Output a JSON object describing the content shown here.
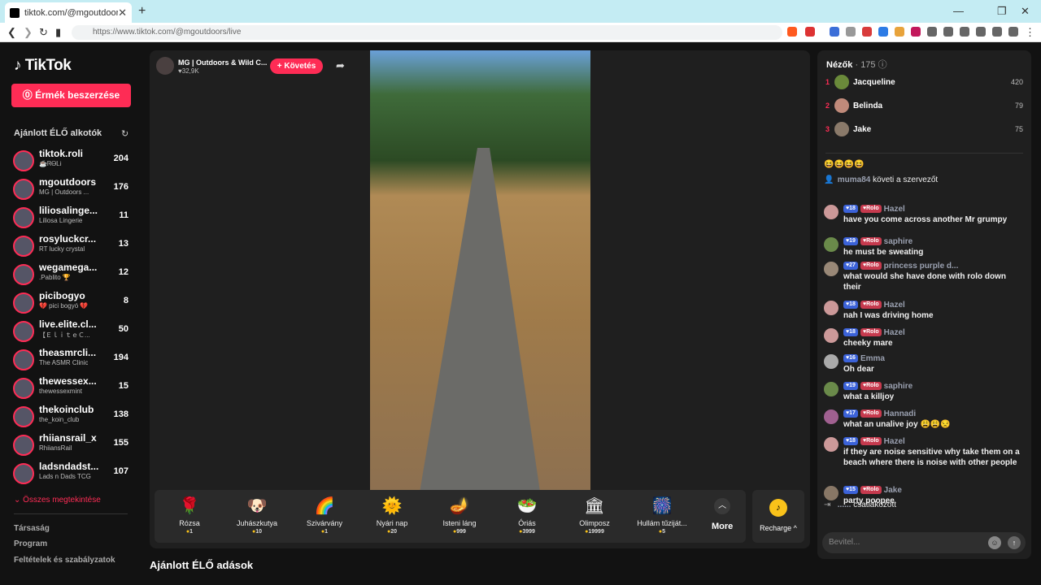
{
  "browser": {
    "tab_title": "tiktok.com/@mgoutdoors/liv",
    "url": "https://www.tiktok.com/@mgoutdoors/live"
  },
  "sidebar": {
    "logo": "TikTok",
    "coins_button": "Érmék beszerzése",
    "section_title": "Ajánlott ÉLŐ alkotók",
    "creators": [
      {
        "username": "tiktok.roli",
        "subtitle": "☕ᏒᎾᏞᎥ",
        "viewers": "204"
      },
      {
        "username": "mgoutdoors",
        "subtitle": "MG | Outdoors ...",
        "viewers": "176"
      },
      {
        "username": "liliosalinge...",
        "subtitle": "Liliosa Lingerie",
        "viewers": "11"
      },
      {
        "username": "rosyluckcr...",
        "subtitle": "RT lucky crystal",
        "viewers": "13"
      },
      {
        "username": "wegamega...",
        "subtitle": ".Pablito 🏆",
        "viewers": "12"
      },
      {
        "username": "picibogyo",
        "subtitle": "💔 pici bogyó 💔",
        "viewers": "8"
      },
      {
        "username": "live.elite.cl...",
        "subtitle": "【ＥｌｉｔｅＣ...",
        "viewers": "50"
      },
      {
        "username": "theasmrcli...",
        "subtitle": "The ASMR Clinic",
        "viewers": "194"
      },
      {
        "username": "thewessex...",
        "subtitle": "thewessexmint",
        "viewers": "15"
      },
      {
        "username": "thekoinclub",
        "subtitle": "the_koin_club",
        "viewers": "138"
      },
      {
        "username": "rhiiansrail_x",
        "subtitle": "RhiiansRail",
        "viewers": "155"
      },
      {
        "username": "ladsndadst...",
        "subtitle": "Lads n Dads TCG",
        "viewers": "107"
      }
    ],
    "see_all": "Összes megtekintése",
    "footer": [
      "Társaság",
      "Program",
      "Feltételek és szabályzatok"
    ]
  },
  "stream": {
    "host_name": "MG | Outdoors & Wild C...",
    "likes": "32,9K",
    "follow_button": "+ Követés",
    "gifts": [
      {
        "name": "Rózsa",
        "price": "1",
        "icon": "🌹"
      },
      {
        "name": "Juhászkutya",
        "price": "10",
        "icon": "🐶"
      },
      {
        "name": "Szivárvány",
        "price": "1",
        "icon": "🌈"
      },
      {
        "name": "Nyári nap",
        "price": "20",
        "icon": "🌞"
      },
      {
        "name": "Isteni láng",
        "price": "999",
        "icon": "🪔"
      },
      {
        "name": "Óriás",
        "price": "3999",
        "icon": "🥗"
      },
      {
        "name": "Olimposz",
        "price": "19999",
        "icon": "🏛"
      },
      {
        "name": "Hullám tűziját...",
        "price": "5",
        "icon": "🎆"
      }
    ],
    "more_label": "More",
    "recharge_label": "Recharge",
    "recommended_title": "Ajánlott ÉLŐ adások"
  },
  "viewers_panel": {
    "title": "Nézők",
    "count": "· 175",
    "top": [
      {
        "rank": "1",
        "name": "Jacqueline",
        "score": "420"
      },
      {
        "rank": "2",
        "name": "Belinda",
        "score": "79"
      },
      {
        "rank": "3",
        "name": "Jake",
        "score": "75"
      }
    ]
  },
  "chat": {
    "follow_event": {
      "user": "muma84",
      "text": "követi a szervezőt"
    },
    "messages": [
      {
        "level": "18",
        "badge": "Rolo",
        "name": "Hazel",
        "text": "have you come across another Mr grumpy"
      },
      {
        "level": "19",
        "badge": "Rolo",
        "name": "saphire",
        "text": "he must be sweating"
      },
      {
        "level": "27",
        "badge": "Rolo",
        "name": "princess purple d...",
        "text": "what would she have done with rolo down their"
      },
      {
        "level": "18",
        "badge": "Rolo",
        "name": "Hazel",
        "text": "nah I was driving home"
      },
      {
        "level": "18",
        "badge": "Rolo",
        "name": "Hazel",
        "text": "cheeky mare"
      },
      {
        "level": "16",
        "badge": "",
        "name": "Emma",
        "text": "Oh dear"
      },
      {
        "level": "19",
        "badge": "Rolo",
        "name": "saphire",
        "text": "what a killjoy"
      },
      {
        "level": "17",
        "badge": "Rolo",
        "name": "Hannadi",
        "text": "what an unalive joy 😩😩😒"
      },
      {
        "level": "18",
        "badge": "Rolo",
        "name": "Hazel",
        "text": "if they are noise sensitive why take them on a beach where there is noise with other people"
      },
      {
        "level": "15",
        "badge": "Rolo",
        "name": "Jake",
        "text": "party poopee"
      }
    ],
    "joined_event": {
      "user": "......",
      "text": "csatlakozott"
    },
    "input_placeholder": "Bevitel..."
  }
}
